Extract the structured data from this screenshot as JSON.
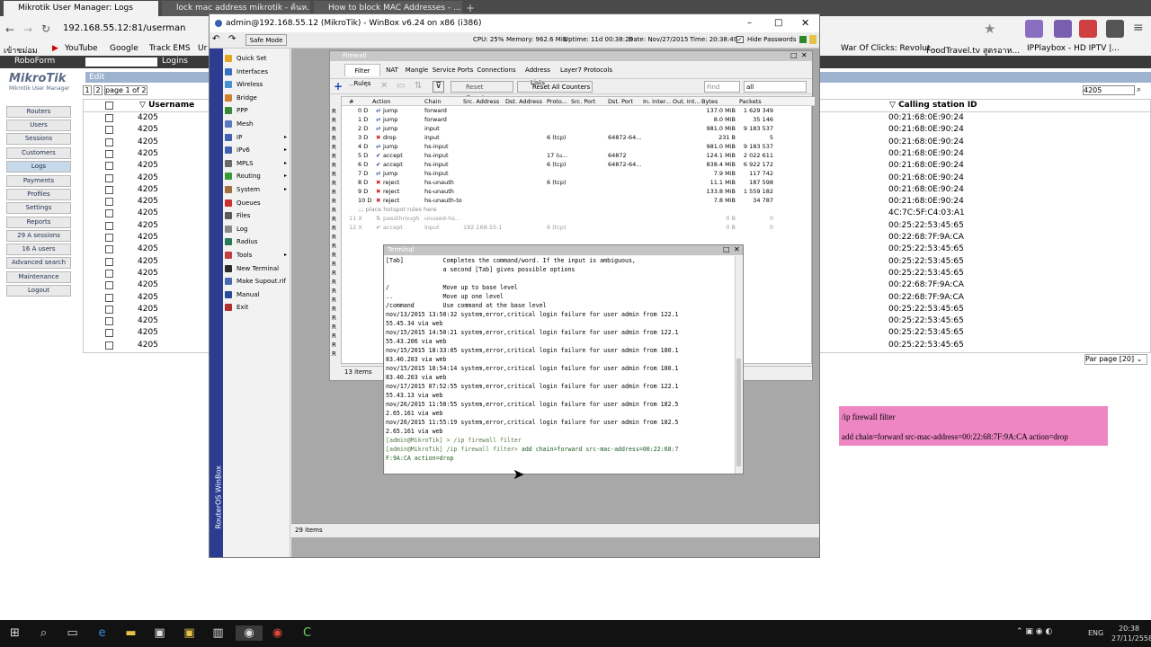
{
  "browser": {
    "tabs": [
      {
        "label": "Mikrotik User Manager: Logs"
      },
      {
        "label": "lock mac address mikrotik - ค้นห..."
      },
      {
        "label": "How to block MAC Addresses - ..."
      }
    ],
    "url": "192.168.55.12:81/userman",
    "bookmarks": [
      "เข้าชม่อม",
      "YouTube",
      "Google",
      "Track EMS",
      "Ur"
    ],
    "bookmarks_right": [
      "War Of Clicks: Revolut...",
      "FoodTravel.tv สูตรอาห...",
      "IPPlaybox - HD IPTV |..."
    ],
    "bookmarks2": [
      "RoboForm",
      "Logins"
    ],
    "search_box": "4205"
  },
  "userman": {
    "logo": "MikroTik",
    "logo_sub": "Mikrotik User Manager",
    "edit_label": "Edit",
    "pages": [
      "1",
      "2"
    ],
    "page_of": "page 1 of 2",
    "nav": [
      "Routers",
      "Users",
      "Sessions",
      "Customers",
      "Logs",
      "Payments",
      "Profiles",
      "Settings",
      "Reports",
      "29 A sessions",
      "16 A users",
      "Advanced search",
      "Maintenance",
      "Logout"
    ],
    "col_username": "Username",
    "col_calling": "Calling station ID",
    "usernames": [
      "4205",
      "4205",
      "4205",
      "4205",
      "4205",
      "4205",
      "4205",
      "4205",
      "4205",
      "4205",
      "4205",
      "4205",
      "4205",
      "4205",
      "4205",
      "4205",
      "4205",
      "4205",
      "4205",
      "4205"
    ],
    "calling_ids": [
      "00:21:68:0E:90:24",
      "00:21:68:0E:90:24",
      "00:21:68:0E:90:24",
      "00:21:68:0E:90:24",
      "00:21:68:0E:90:24",
      "00:21:68:0E:90:24",
      "00:21:68:0E:90:24",
      "00:21:68:0E:90:24",
      "4C:7C:5F:C4:03:A1",
      "00:25:22:53:45:65",
      "00:22:68:7F:9A:CA",
      "00:25:22:53:45:65",
      "00:25:22:53:45:65",
      "00:25:22:53:45:65",
      "00:22:68:7F:9A:CA",
      "00:22:68:7F:9A:CA",
      "00:25:22:53:45:65",
      "00:25:22:53:45:65",
      "00:25:22:53:45:65",
      "00:25:22:53:45:65"
    ],
    "per_page": "Par page [20]"
  },
  "winbox": {
    "title": "admin@192.168.55.12 (MikroTik) - WinBox v6.24 on x86 (i386)",
    "safe_mode": "Safe Mode",
    "cpu": "CPU: 25%",
    "memory": "Memory: 962.6 MiB",
    "uptime": "Uptime: 11d 00:38:28",
    "date": "Date: Nov/27/2015",
    "time": "Time: 20:38:49",
    "hide_pw": "Hide Passwords",
    "side_label": "RouterOS WinBox",
    "menu": [
      "Quick Set",
      "Interfaces",
      "Wireless",
      "Bridge",
      "PPP",
      "Mesh",
      "IP",
      "IPv6",
      "MPLS",
      "Routing",
      "System",
      "Queues",
      "Files",
      "Log",
      "Radius",
      "Tools",
      "New Terminal",
      "Make Supout.rif",
      "Manual",
      "Exit"
    ],
    "desk_items": "29 items"
  },
  "firewall": {
    "title": "Firewall",
    "tabs": [
      "Filter Rules",
      "NAT",
      "Mangle",
      "Service Ports",
      "Connections",
      "Address Lists",
      "Layer7 Protocols"
    ],
    "reset_counters": "Reset Counters",
    "reset_all": "Reset All Counters",
    "find_placeholder": "Find",
    "filter_all": "all",
    "columns": [
      "#",
      "Action",
      "Chain",
      "Src. Address",
      "Dst. Address",
      "Proto...",
      "Src. Port",
      "Dst. Port",
      "In. Inter...",
      "Out. Int...",
      "Bytes",
      "Packets"
    ],
    "rows": [
      {
        "n": "0 D",
        "action": "jump",
        "chain": "forward",
        "src": "",
        "proto": "",
        "dport": "",
        "bytes": "137.0 MiB",
        "packets": "1 629 349"
      },
      {
        "n": "1 D",
        "action": "jump",
        "chain": "forward",
        "src": "",
        "proto": "",
        "dport": "",
        "bytes": "8.0 MiB",
        "packets": "35 146"
      },
      {
        "n": "2 D",
        "action": "jump",
        "chain": "input",
        "src": "",
        "proto": "",
        "dport": "",
        "bytes": "981.0 MiB",
        "packets": "9 183 537"
      },
      {
        "n": "3 D",
        "action": "drop",
        "chain": "input",
        "src": "",
        "proto": "6 (tcp)",
        "dport": "64872-64...",
        "bytes": "231 B",
        "packets": "5"
      },
      {
        "n": "4 D",
        "action": "jump",
        "chain": "hs-input",
        "src": "",
        "proto": "",
        "dport": "",
        "bytes": "981.0 MiB",
        "packets": "9 183 537"
      },
      {
        "n": "5 D",
        "action": "accept",
        "chain": "hs-input",
        "src": "",
        "proto": "17 (u...",
        "dport": "64872",
        "bytes": "124.1 MiB",
        "packets": "2 022 611"
      },
      {
        "n": "6 D",
        "action": "accept",
        "chain": "hs-input",
        "src": "",
        "proto": "6 (tcp)",
        "dport": "64872-64...",
        "bytes": "838.4 MiB",
        "packets": "6 922 172"
      },
      {
        "n": "7 D",
        "action": "jump",
        "chain": "hs-input",
        "src": "",
        "proto": "",
        "dport": "",
        "bytes": "7.9 MiB",
        "packets": "117 742"
      },
      {
        "n": "8 D",
        "action": "reject",
        "chain": "hs-unauth",
        "src": "",
        "proto": "6 (tcp)",
        "dport": "",
        "bytes": "11.1 MiB",
        "packets": "187 598"
      },
      {
        "n": "9 D",
        "action": "reject",
        "chain": "hs-unauth",
        "src": "",
        "proto": "",
        "dport": "",
        "bytes": "133.8 MiB",
        "packets": "1 559 182"
      },
      {
        "n": "10 D",
        "action": "reject",
        "chain": "hs-unauth-to",
        "src": "",
        "proto": "",
        "dport": "",
        "bytes": "7.8 MiB",
        "packets": "34 787"
      }
    ],
    "comment": ";;; place hotspot rules here",
    "disabled_rows": [
      {
        "n": "11 X",
        "action": "passthrough",
        "chain": "unused-hs...",
        "src": "",
        "proto": "",
        "bytes": "0 B",
        "packets": "0"
      },
      {
        "n": "12 X",
        "action": "accept",
        "chain": "input",
        "src": "192.168.55.1",
        "proto": "6 (tcp)",
        "bytes": "0 B",
        "packets": "0"
      }
    ],
    "items": "13 items"
  },
  "terminal": {
    "title": "Terminal",
    "lines": [
      "[Tab]           Completes the command/word. If the input is ambiguous,",
      "                a second [Tab] gives possible options",
      "",
      "/               Move up to base level",
      "..              Move up one level",
      "/command        Use command at the base level",
      "nov/13/2015 13:50:32 system,error,critical login failure for user admin from 122.1",
      "55.45.34 via web",
      "nov/15/2015 14:50:21 system,error,critical login failure for user admin from 122.1",
      "55.43.206 via web",
      "nov/15/2015 18:33:05 system,error,critical login failure for user admin from 180.1",
      "83.40.203 via web",
      "nov/15/2015 18:54:14 system,error,critical login failure for user admin from 180.1",
      "83.40.203 via web",
      "nov/17/2015 07:52:55 system,error,critical login failure for user admin from 122.1",
      "55.43.13 via web",
      "nov/26/2015 11:50:55 system,error,critical login failure for user admin from 182.5",
      "2.65.161 via web",
      "nov/26/2015 11:55:19 system,error,critical login failure for user admin from 182.5",
      "2.65.161 via web"
    ],
    "prompt1": "[admin@MikroTik] > /ip firewall filter",
    "prompt2_a": "[admin@MikroTik] /ip firewall filter> ",
    "prompt2_b": "add chain=forward src-mac-address=00:22:68:7",
    "prompt3": "F:9A:CA action=drop"
  },
  "note": {
    "line1": "/ip firewall filter",
    "line2": "add chain=forward src-mac-address=00:22:68:7F:9A:CA action=drop"
  },
  "taskbar": {
    "lang": "ENG",
    "time": "20:38",
    "date": "27/11/2558"
  },
  "colors": {
    "winbox_side": "#2c3c91",
    "note_bg": "#ee86c4",
    "taskbar": "#121212"
  }
}
